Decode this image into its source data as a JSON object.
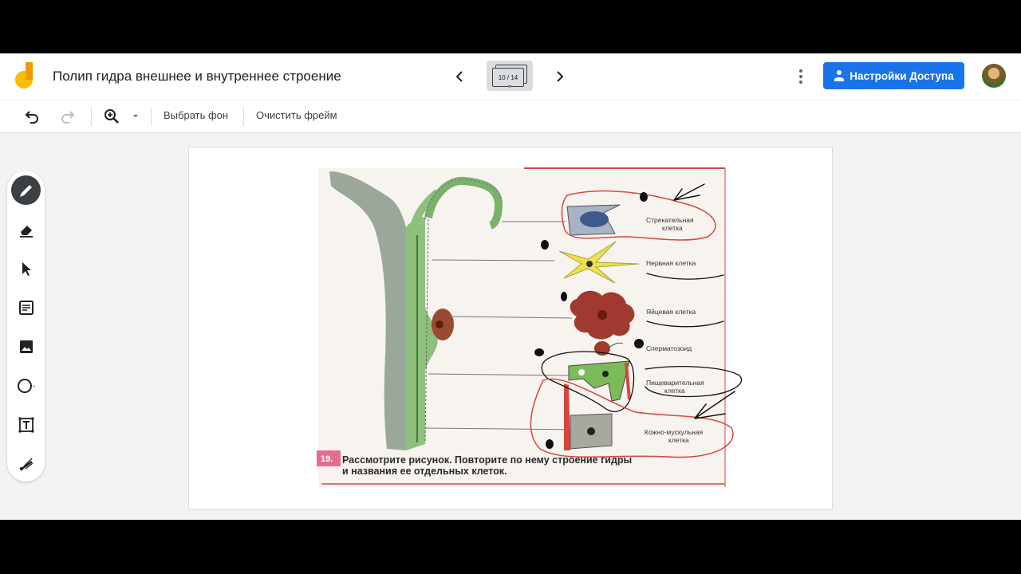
{
  "header": {
    "title": "Полип гидра внешнее и внутреннее строение",
    "frame_counter": "10 / 14",
    "share_label": "Настройки Доступа",
    "accent_color": "#1a73e8"
  },
  "toolbar": {
    "bg_label": "Выбрать фон",
    "clear_label": "Очистить фрейм"
  },
  "side_tools": [
    "pen-icon",
    "eraser-icon",
    "select-icon",
    "sticky-note-icon",
    "image-icon",
    "circle-icon",
    "text-box-icon",
    "laser-icon"
  ],
  "figure": {
    "labels": {
      "stinging": [
        "Стрекательная",
        "клетка"
      ],
      "nerve": "Нервная клетка",
      "egg": "Яйцевая клетка",
      "sperm": "Сперматозоид",
      "digestive": [
        "Пищеварительная",
        "клетка"
      ],
      "skin_muscle": [
        "Кожно-мускульная",
        "клетка"
      ]
    },
    "number": "19.",
    "caption_line1": "Рассмотрите рисунок. Повторите по нему строение гидры",
    "caption_line2": "и названия ее отдельных клеток."
  }
}
